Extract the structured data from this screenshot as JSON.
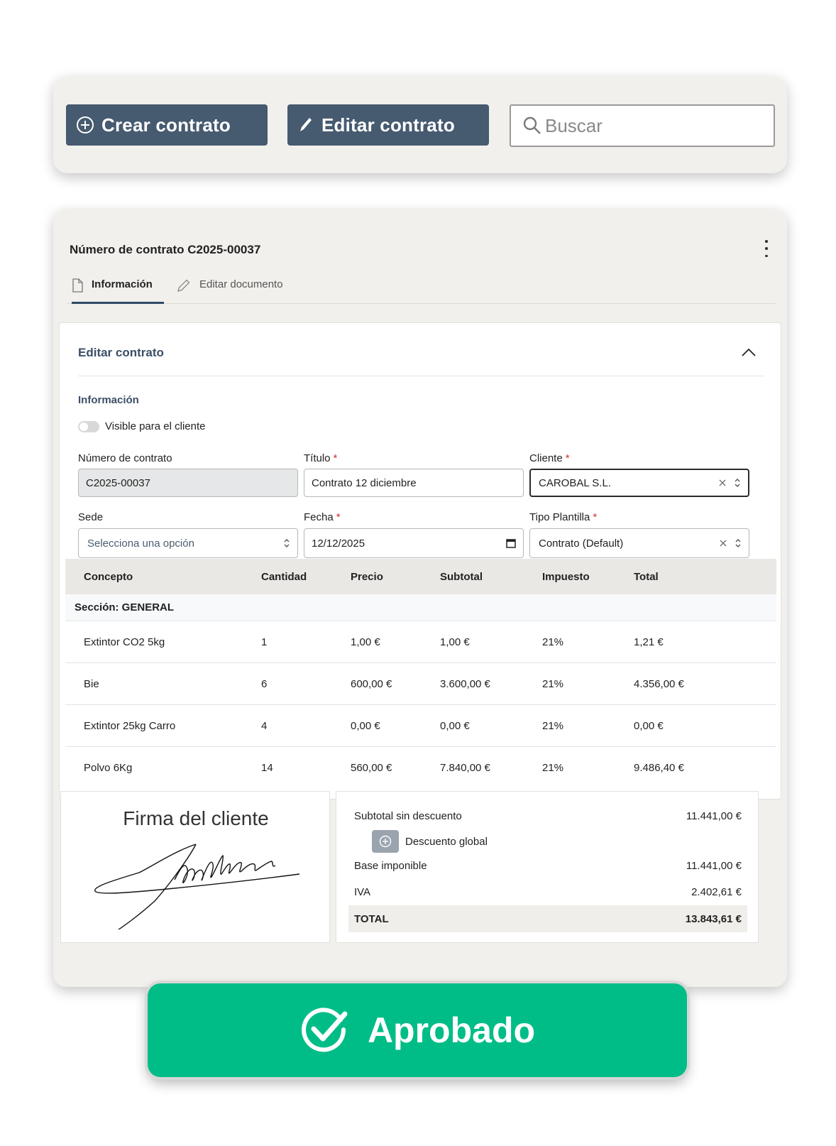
{
  "toolbar": {
    "create_label": "Crear contrato",
    "edit_label": "Editar contrato",
    "search_placeholder": "Buscar"
  },
  "contract": {
    "title": "Número de contrato C2025-00037",
    "tabs": [
      {
        "label": "Información"
      },
      {
        "label": "Editar documento"
      }
    ]
  },
  "form": {
    "card_title": "Editar contrato",
    "section_label": "Información",
    "visible_label": "Visible para el cliente",
    "visible_on": false,
    "numero_label": "Número de contrato",
    "numero_value": "C2025-00037",
    "titulo_label": "Título",
    "titulo_value": "Contrato 12 diciembre",
    "cliente_label": "Cliente",
    "cliente_value": "CAROBAL S.L.",
    "sede_label": "Sede",
    "sede_placeholder": "Selecciona una opción",
    "fecha_label": "Fecha",
    "fecha_value": "12/12/2025",
    "plantilla_label": "Tipo Plantilla",
    "plantilla_value": "Contrato (Default)",
    "required_mark": "*"
  },
  "table": {
    "headers": [
      "Concepto",
      "Cantidad",
      "Precio",
      "Subtotal",
      "Impuesto",
      "Total"
    ],
    "section": "Sección: GENERAL",
    "rows": [
      [
        "Extintor CO2 5kg",
        "1",
        "1,00 €",
        "1,00 €",
        "21%",
        "1,21 €"
      ],
      [
        "Bie",
        "6",
        "600,00 €",
        "3.600,00 €",
        "21%",
        "4.356,00 €"
      ],
      [
        "Extintor 25kg Carro",
        "4",
        "0,00 €",
        "0,00 €",
        "21%",
        "0,00 €"
      ],
      [
        "Polvo 6Kg",
        "14",
        "560,00 €",
        "7.840,00 €",
        "21%",
        "9.486,40 €"
      ]
    ]
  },
  "signature": {
    "title": "Firma del cliente"
  },
  "totals": {
    "subtotal_label": "Subtotal sin descuento",
    "subtotal_value": "11.441,00 €",
    "discount_label": "Descuento global",
    "base_label": "Base imponible",
    "base_value": "11.441,00 €",
    "iva_label": "IVA",
    "iva_value": "2.402,61 €",
    "total_label": "TOTAL",
    "total_value": "13.843,61 €"
  },
  "status": {
    "label": "Aprobado",
    "color": "#00bd87"
  },
  "colors": {
    "primary": "#465a70",
    "accent_text": "#3a4f66",
    "required": "#d03030"
  }
}
